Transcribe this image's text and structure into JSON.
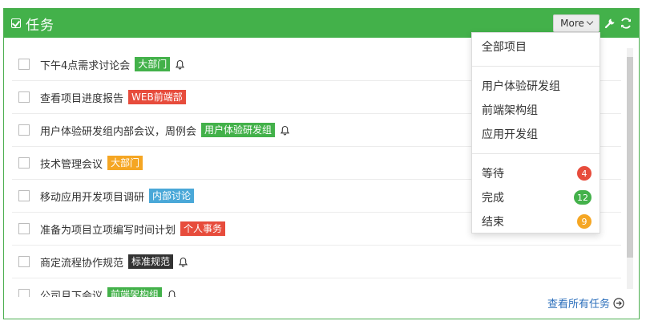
{
  "header": {
    "title": "任务",
    "more_label": "More",
    "color": "#43b14a"
  },
  "tasks": [
    {
      "text": "下午4点需求讨论会",
      "tag": "大部门",
      "tag_color": "#43b14a",
      "bell": true
    },
    {
      "text": "查看项目进度报告",
      "tag": "WEB前端部",
      "tag_color": "#e74c3c",
      "bell": false
    },
    {
      "text": "用户体验研发组内部会议，周例会",
      "tag": "用户体验研发组",
      "tag_color": "#43b14a",
      "bell": true
    },
    {
      "text": "技术管理会议",
      "tag": "大部门",
      "tag_color": "#f5a623",
      "bell": false
    },
    {
      "text": "移动应用开发项目调研",
      "tag": "内部讨论",
      "tag_color": "#4aa8d8",
      "bell": false
    },
    {
      "text": "准备为项目立项编写时间计划",
      "tag": "个人事务",
      "tag_color": "#e74c3c",
      "bell": false
    },
    {
      "text": "商定流程协作规范",
      "tag": "标准规范",
      "tag_color": "#333333",
      "bell": true
    },
    {
      "text": "公司月下会议",
      "tag": "前端架构组",
      "tag_color": "#43b14a",
      "bell": true
    }
  ],
  "footer": {
    "view_all_label": "查看所有任务"
  },
  "dropdown": {
    "all_label": "全部项目",
    "groups": [
      "用户体验研发组",
      "前端架构组",
      "应用开发组"
    ],
    "statuses": [
      {
        "label": "等待",
        "count": "4",
        "color": "#e74c3c"
      },
      {
        "label": "完成",
        "count": "12",
        "color": "#43b14a"
      },
      {
        "label": "结束",
        "count": "9",
        "color": "#f5a623"
      }
    ]
  }
}
